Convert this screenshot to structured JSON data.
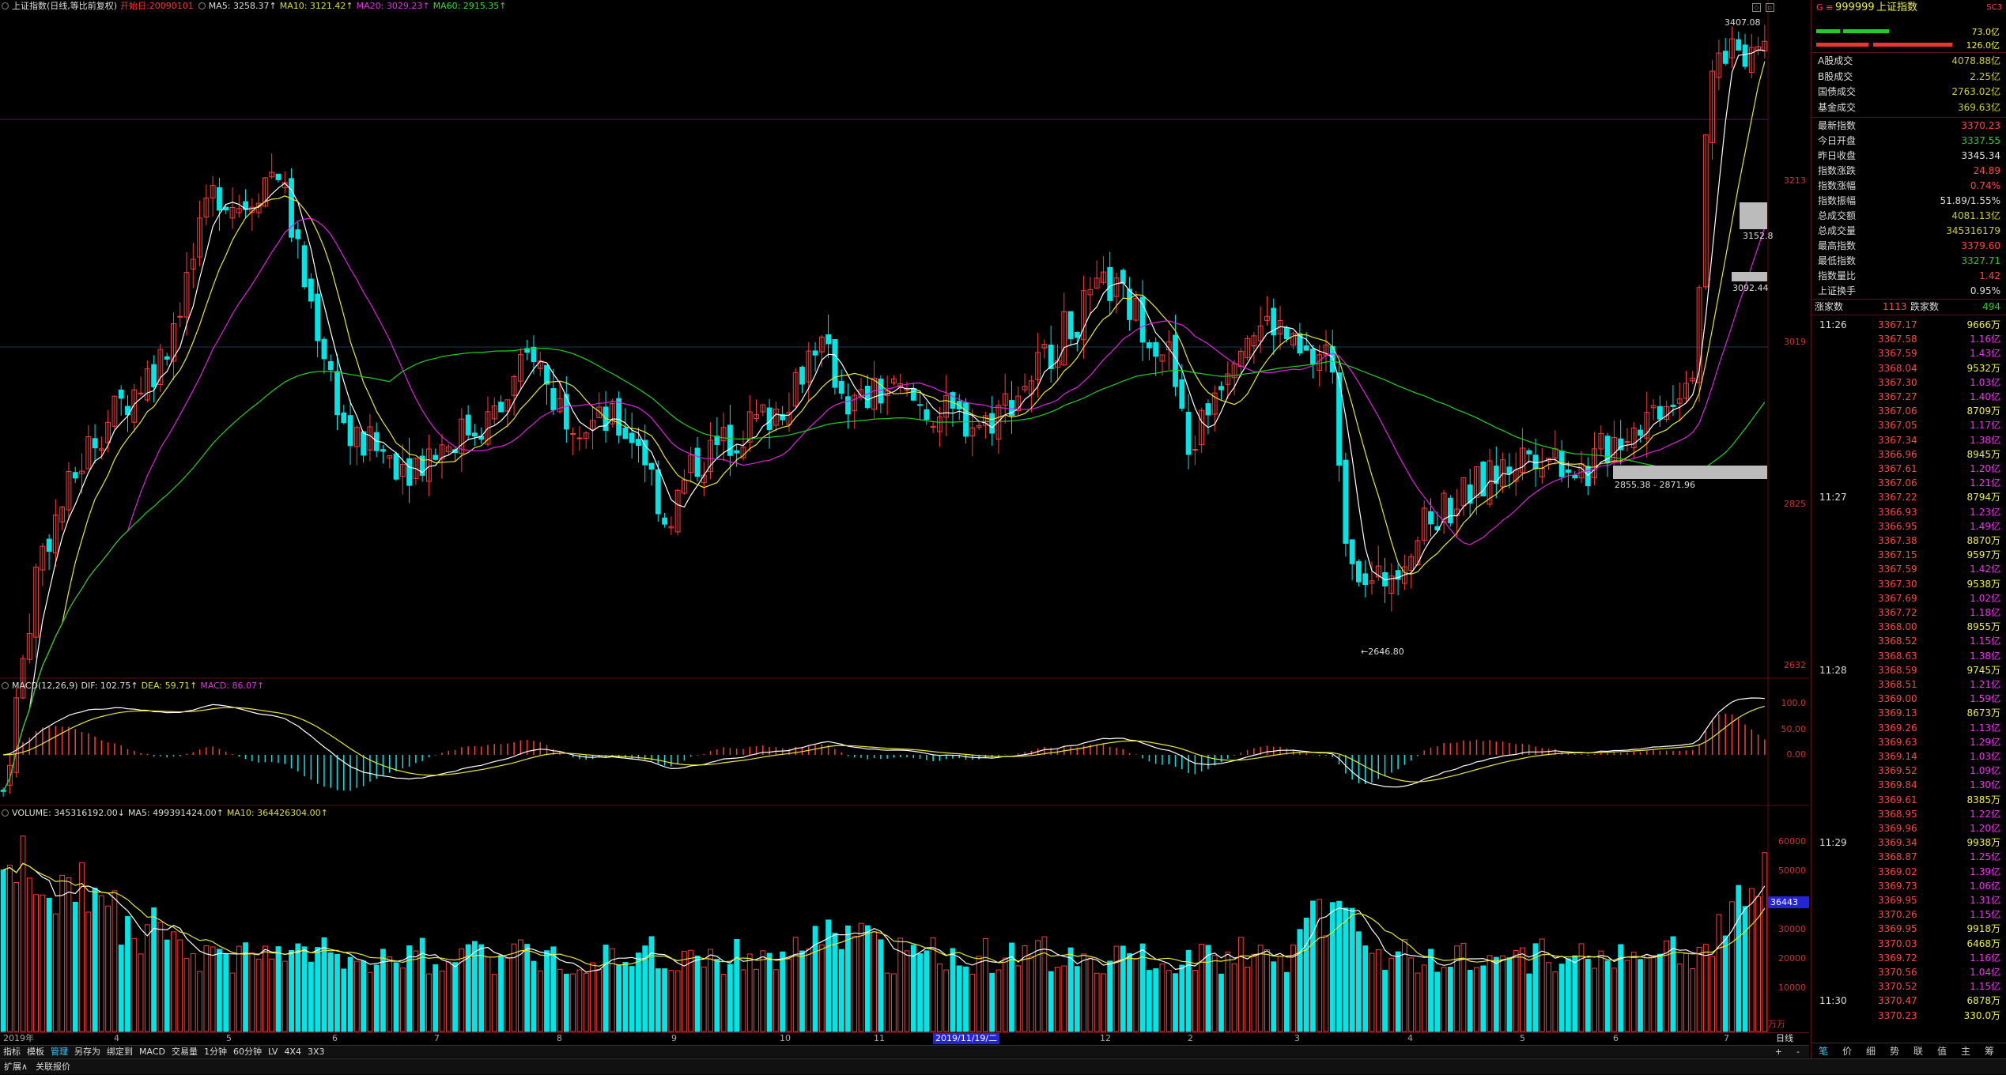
{
  "kline_header": {
    "title": "上证指数(日线,等比前复权)",
    "start_date": "开始日:20090101",
    "ma5": "MA5: 3258.37↑",
    "ma10": "MA10: 3121.42↑",
    "ma20": "MA20: 3029.23↑",
    "ma60": "MA60: 2915.35↑"
  },
  "macd_header": {
    "name": "MACD(12,26,9)",
    "dif": "DIF: 102.75↑",
    "dea": "DEA: 59.71↑",
    "macd": "MACD: 86.07↑"
  },
  "volume_header": {
    "name": "VOLUME: 345316192.00↓",
    "ma5": "MA5: 499391424.00↑",
    "ma10": "MA10: 364426304.00↑"
  },
  "price_axis": [
    "3213",
    "3019",
    "2825",
    "2632"
  ],
  "macd_axis": [
    "100.0",
    "50.00",
    "0.00"
  ],
  "volume_axis": [
    "60000",
    "50000",
    "40000",
    "30000",
    "20000",
    "10000"
  ],
  "volume_marker": "36443",
  "volume_unit": "万万",
  "annotations": {
    "high": "3407.08",
    "low": "←2646.80",
    "gap1": "3152.8",
    "gap2": "3092.44",
    "gap3": "2855.38 - 2871.96"
  },
  "x_labels": [
    "2019年",
    "4",
    "5",
    "6",
    "7",
    "8",
    "9",
    "10",
    "11",
    "12",
    "2",
    "3",
    "4",
    "5",
    "6",
    "7"
  ],
  "crosshair_date": "2019/11/19/二",
  "toolbar": [
    "指标",
    "模板",
    "管理",
    "另存为",
    "绑定到",
    "MACD",
    "交易量",
    "1分钟",
    "60分钟",
    "LV",
    "4X4",
    "3X3"
  ],
  "toolbar_active": "管理",
  "period_label": "日线",
  "status_bar": [
    "扩展∧",
    "关联报价"
  ],
  "quote": {
    "code": "999999",
    "name": "上证指数",
    "flag": "SC3",
    "bar1": "73.0亿",
    "bar2": "126.0亿",
    "rows1": [
      {
        "k": "A股成交",
        "v": "4078.88亿",
        "c": "yel"
      },
      {
        "k": "B股成交",
        "v": "2.25亿",
        "c": "yel"
      },
      {
        "k": "国债成交",
        "v": "2763.02亿",
        "c": "yel"
      },
      {
        "k": "基金成交",
        "v": "369.63亿",
        "c": "yel"
      }
    ],
    "rows2": [
      {
        "k": "最新指数",
        "v": "3370.23",
        "c": "red"
      },
      {
        "k": "今日开盘",
        "v": "3337.55",
        "c": "green"
      },
      {
        "k": "昨日收盘",
        "v": "3345.34",
        "c": "wht"
      },
      {
        "k": "指数涨跌",
        "v": "24.89",
        "c": "red"
      },
      {
        "k": "指数涨幅",
        "v": "0.74%",
        "c": "red"
      },
      {
        "k": "指数振幅",
        "v": "51.89/1.55%",
        "c": "wht"
      },
      {
        "k": "总成交额",
        "v": "4081.13亿",
        "c": "yel"
      },
      {
        "k": "总成交量",
        "v": "345316179",
        "c": "yel"
      },
      {
        "k": "最高指数",
        "v": "3379.60",
        "c": "red"
      },
      {
        "k": "最低指数",
        "v": "3327.71",
        "c": "green"
      },
      {
        "k": "指数量比",
        "v": "1.42",
        "c": "red"
      },
      {
        "k": "上证换手",
        "v": "0.95%",
        "c": "wht"
      }
    ],
    "updown": {
      "up_label": "涨家数",
      "up": "1113",
      "down_label": "跌家数",
      "down": "494"
    },
    "ticks": [
      {
        "t": "11:26",
        "p": "3367.17",
        "q": "9666万"
      },
      {
        "t": "",
        "p": "3367.58",
        "q": "1.16亿"
      },
      {
        "t": "",
        "p": "3367.59",
        "q": "1.43亿"
      },
      {
        "t": "",
        "p": "3368.04",
        "q": "9532万"
      },
      {
        "t": "",
        "p": "3367.30",
        "q": "1.03亿"
      },
      {
        "t": "",
        "p": "3367.27",
        "q": "1.40亿"
      },
      {
        "t": "",
        "p": "3367.06",
        "q": "8709万"
      },
      {
        "t": "",
        "p": "3367.05",
        "q": "1.17亿"
      },
      {
        "t": "",
        "p": "3367.34",
        "q": "1.38亿"
      },
      {
        "t": "",
        "p": "3366.96",
        "q": "8945万"
      },
      {
        "t": "",
        "p": "3367.61",
        "q": "1.20亿"
      },
      {
        "t": "",
        "p": "3367.06",
        "q": "1.21亿"
      },
      {
        "t": "11:27",
        "p": "3367.22",
        "q": "8794万"
      },
      {
        "t": "",
        "p": "3366.93",
        "q": "1.23亿"
      },
      {
        "t": "",
        "p": "3366.95",
        "q": "1.49亿"
      },
      {
        "t": "",
        "p": "3367.38",
        "q": "8870万"
      },
      {
        "t": "",
        "p": "3367.15",
        "q": "9597万"
      },
      {
        "t": "",
        "p": "3367.59",
        "q": "1.42亿"
      },
      {
        "t": "",
        "p": "3367.30",
        "q": "9538万"
      },
      {
        "t": "",
        "p": "3367.69",
        "q": "1.02亿"
      },
      {
        "t": "",
        "p": "3367.72",
        "q": "1.18亿"
      },
      {
        "t": "",
        "p": "3368.00",
        "q": "8955万"
      },
      {
        "t": "",
        "p": "3368.52",
        "q": "1.15亿"
      },
      {
        "t": "",
        "p": "3368.63",
        "q": "1.38亿"
      },
      {
        "t": "11:28",
        "p": "3368.59",
        "q": "9745万"
      },
      {
        "t": "",
        "p": "3368.51",
        "q": "1.21亿"
      },
      {
        "t": "",
        "p": "3369.00",
        "q": "1.59亿"
      },
      {
        "t": "",
        "p": "3369.13",
        "q": "8673万"
      },
      {
        "t": "",
        "p": "3369.26",
        "q": "1.13亿"
      },
      {
        "t": "",
        "p": "3369.63",
        "q": "1.29亿"
      },
      {
        "t": "",
        "p": "3369.14",
        "q": "1.03亿"
      },
      {
        "t": "",
        "p": "3369.52",
        "q": "1.09亿"
      },
      {
        "t": "",
        "p": "3369.84",
        "q": "1.30亿"
      },
      {
        "t": "",
        "p": "3369.61",
        "q": "8385万"
      },
      {
        "t": "",
        "p": "3368.95",
        "q": "1.22亿"
      },
      {
        "t": "",
        "p": "3369.96",
        "q": "1.20亿"
      },
      {
        "t": "11:29",
        "p": "3369.34",
        "q": "9938万"
      },
      {
        "t": "",
        "p": "3368.87",
        "q": "1.25亿"
      },
      {
        "t": "",
        "p": "3369.02",
        "q": "1.39亿"
      },
      {
        "t": "",
        "p": "3369.73",
        "q": "1.06亿"
      },
      {
        "t": "",
        "p": "3369.95",
        "q": "1.31亿"
      },
      {
        "t": "",
        "p": "3370.26",
        "q": "1.15亿"
      },
      {
        "t": "",
        "p": "3369.95",
        "q": "9918万"
      },
      {
        "t": "",
        "p": "3370.03",
        "q": "6468万"
      },
      {
        "t": "",
        "p": "3369.72",
        "q": "1.16亿"
      },
      {
        "t": "",
        "p": "3370.56",
        "q": "1.04亿"
      },
      {
        "t": "",
        "p": "3370.52",
        "q": "1.15亿"
      },
      {
        "t": "11:30",
        "p": "3370.47",
        "q": "6878万"
      },
      {
        "t": "",
        "p": "3370.23",
        "q": "330.0万"
      }
    ],
    "tabs": [
      "笔",
      "价",
      "细",
      "势",
      "联",
      "值",
      "主",
      "筹"
    ],
    "tab_active": "笔"
  },
  "chart_data": {
    "type": "candlestick",
    "title": "上证指数(日线,等比前复权)",
    "price_range": [
      2632,
      3407.08
    ],
    "high": 3407.08,
    "low": 2646.8,
    "last_close": 3370.23,
    "ma_latest": {
      "MA5": 3258.37,
      "MA10": 3121.42,
      "MA20": 3029.23,
      "MA60": 2915.35
    },
    "macd_latest": {
      "DIF": 102.75,
      "DEA": 59.71,
      "MACD": 86.07
    },
    "volume_latest": {
      "VOLUME": 345316192.0,
      "MA5": 499391424.0,
      "MA10": 364426304.0
    },
    "colors": {
      "up": "#ff3a3a",
      "down": "#00e5e5",
      "ma5": "#ffffff",
      "ma10": "#e8e830",
      "ma20": "#e020e0",
      "ma60": "#20d020"
    }
  }
}
